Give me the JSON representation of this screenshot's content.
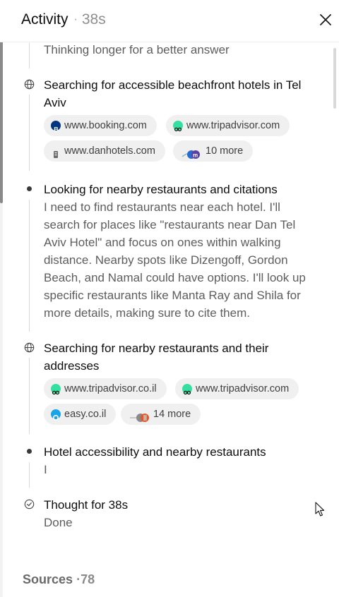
{
  "header": {
    "title": "Activity",
    "separator": "·",
    "elapsed": "38s"
  },
  "items": [
    {
      "kind": "text",
      "title": "",
      "body": "Thinking longer for a better answer"
    },
    {
      "kind": "search",
      "icon": "globe-icon",
      "title_line1": "Searching for accessible beachfront hotels in Tel",
      "title_line2": "Aviv",
      "chips": [
        "www.booking.com",
        "www.tripadvisor.com",
        "www.danhotels.com",
        "10 more"
      ]
    },
    {
      "kind": "thought",
      "icon": "bullet-icon",
      "title": "Looking for nearby restaurants and citations",
      "body_lines": [
        "I need to find restaurants near each hotel. I'll",
        "search for places like \"restaurants near Dan Tel",
        "Aviv Hotel\" and focus on ones within walking",
        "distance. Nearby spots like Dizengoff, Gordon",
        "Beach, and Namal could have options. I'll look up",
        "specific restaurants like Manta Ray and Shila for",
        "more details, making sure to cite them."
      ]
    },
    {
      "kind": "search",
      "icon": "globe-icon",
      "title_line1": "Searching for nearby restaurants and their",
      "title_line2": "addresses",
      "chips": [
        "www.tripadvisor.co.il",
        "www.tripadvisor.com",
        "easy.co.il",
        "14 more"
      ]
    },
    {
      "kind": "thought",
      "icon": "bullet-icon",
      "title": "Hotel accessibility and nearby restaurants",
      "body": "I"
    },
    {
      "kind": "done",
      "icon": "check-circle-icon",
      "title": "Thought for 38s",
      "body": "Done"
    }
  ],
  "sources": {
    "label": "Sources",
    "separator": "·",
    "count": "78"
  },
  "colors": {
    "tripadvisor": "#34e0a1",
    "booking": "#003580",
    "easy": "#1aa3e8",
    "muted_text": "#5d5d5d"
  }
}
